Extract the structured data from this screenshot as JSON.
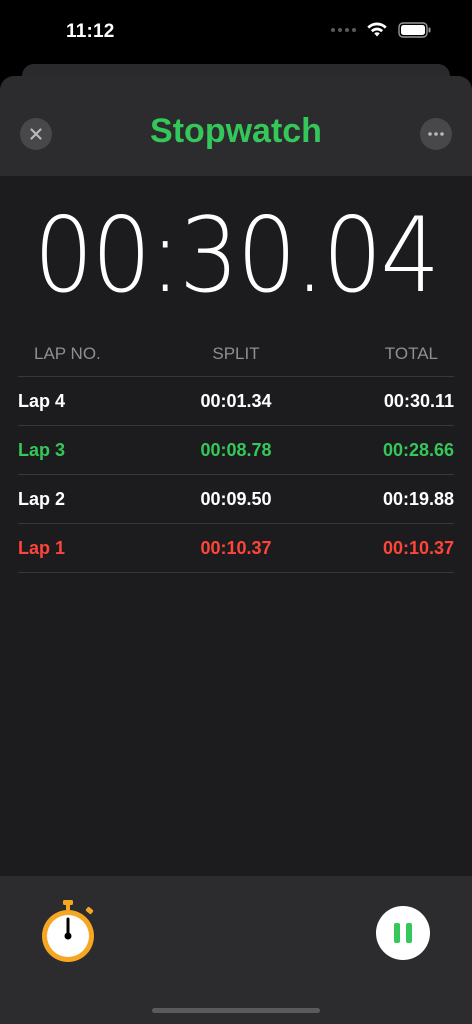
{
  "status_bar": {
    "time": "11:12"
  },
  "nav": {
    "title": "Stopwatch"
  },
  "timer": {
    "display": "00:30.04"
  },
  "laps": {
    "headers": [
      "LAP NO.",
      "SPLIT",
      "TOTAL"
    ],
    "rows": [
      {
        "lap": "Lap 4",
        "split": "00:01.34",
        "total": "00:30.11",
        "state": "normal"
      },
      {
        "lap": "Lap 3",
        "split": "00:08.78",
        "total": "00:28.66",
        "state": "best"
      },
      {
        "lap": "Lap 2",
        "split": "00:09.50",
        "total": "00:19.88",
        "state": "normal"
      },
      {
        "lap": "Lap 1",
        "split": "00:10.37",
        "total": "00:10.37",
        "state": "worst"
      }
    ]
  },
  "colors": {
    "accent_green": "#34c759",
    "accent_red": "#ff453a",
    "stopwatch_orange": "#f5a623"
  },
  "icons": {
    "close": "close-icon",
    "more": "ellipsis-icon",
    "stopwatch": "stopwatch-icon",
    "pause": "pause-icon"
  }
}
